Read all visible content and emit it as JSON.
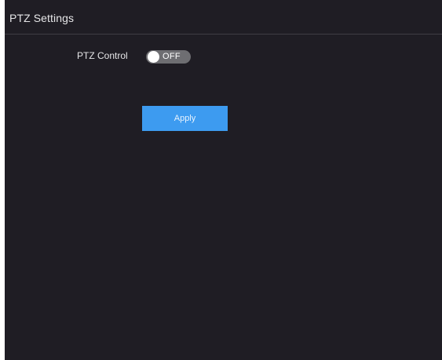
{
  "panel": {
    "title": "PTZ Settings"
  },
  "settings": {
    "ptz_control": {
      "label": "PTZ Control",
      "state_text": "OFF",
      "enabled": false
    }
  },
  "actions": {
    "apply_label": "Apply"
  },
  "colors": {
    "panel_background": "#1f1d24",
    "toggle_off": "#6e6e72",
    "accent": "#3d9bf0"
  }
}
